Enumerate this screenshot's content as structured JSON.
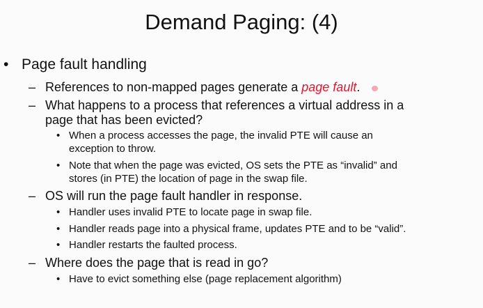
{
  "slide": {
    "title": "Demand Paging: (4)",
    "bullet_marker": "•",
    "dash_marker": "–",
    "bullet": "Page fault handling",
    "item1_before": "References to non-mapped pages generate a ",
    "item1_highlight": "page fault",
    "item1_after": ".",
    "item2_line1": "What happens to a process that references a virtual address in a",
    "item2_line2": "page that has been evicted?",
    "item2_sub1_line1": "When a process accesses the page, the invalid PTE will cause an",
    "item2_sub1_line2": "exception to throw.",
    "item2_sub2_line1": "Note that when the page was evicted, OS sets the PTE as “invalid” and",
    "item2_sub2_line2": "stores (in PTE) the location of page in the swap file.",
    "item3": "OS will run the page fault handler in response.",
    "item3_sub1": "Handler uses invalid PTE to locate page in swap file.",
    "item3_sub2": "Handler reads page into a physical frame, updates PTE and to be “valid”.",
    "item3_sub3": "Handler restarts the faulted process.",
    "item4": "Where does the page that is read in go?",
    "item4_sub1": "Have to evict something else (page replacement algorithm)"
  },
  "colors": {
    "highlight": "#e8132b",
    "text": "#111111",
    "background": "#fbfbfb"
  }
}
